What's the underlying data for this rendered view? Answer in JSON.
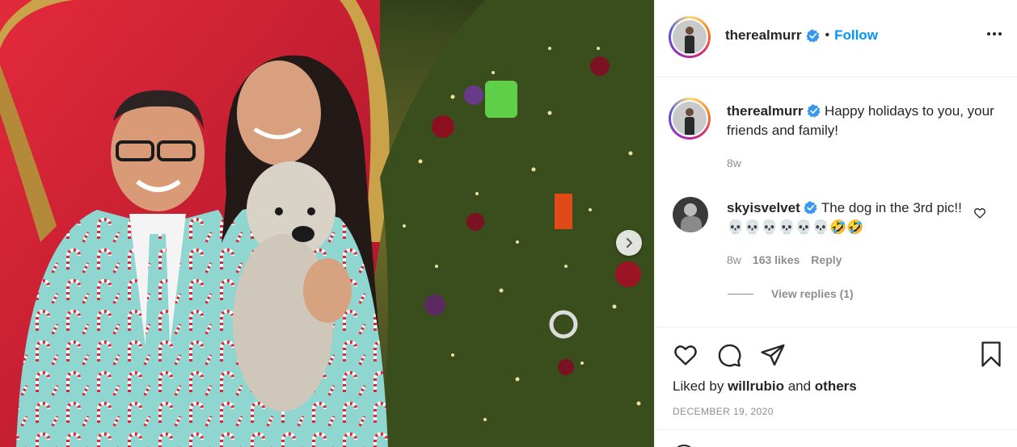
{
  "post": {
    "image_alt": "Couple in candy cane suits with a dog in front of a Christmas tree",
    "next_icon": "chevron-right-icon"
  },
  "header": {
    "username": "therealmurr",
    "separator": "•",
    "follow_label": "Follow",
    "more_icon": "more-options-icon"
  },
  "caption": {
    "username": "therealmurr",
    "text": "Happy holidays to you, your friends and family!",
    "age": "8w"
  },
  "comments": [
    {
      "username": "skyisvelvet",
      "text": "The dog in the 3rd pic!! 💀💀💀💀💀💀🤣🤣",
      "age": "8w",
      "likes": "163 likes",
      "reply_label": "Reply",
      "view_replies": "View replies (1)"
    }
  ],
  "actions": {
    "liked_prefix": "Liked by",
    "liked_user": "willrubio",
    "liked_and": "and",
    "liked_others": "others",
    "date": "DECEMBER 19, 2020"
  },
  "colors": {
    "accent": "#0095f6",
    "muted": "#8e8e8e",
    "text": "#262626",
    "border": "#efefef"
  }
}
